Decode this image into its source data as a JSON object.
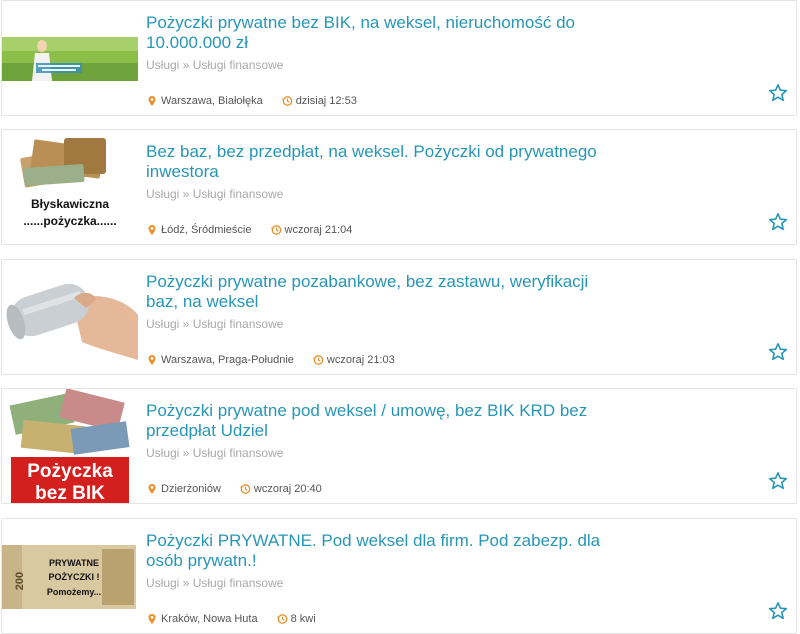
{
  "colors": {
    "title": "#2796b5",
    "category": "#a9a9a9",
    "meta_icon": "#e8912d",
    "star": "#2796b5"
  },
  "listings": [
    {
      "title": "Pożyczki prywatne bez BIK, na weksel, nieruchomość do 10.000.000 zł",
      "category": "Usługi » Usługi finansowe",
      "location": "Warszawa, Białołęka",
      "time": "dzisiaj 12:53",
      "thumb_icon": "woman-in-field-photo"
    },
    {
      "title": "Bez baz, bez przedpłat, na weksel. Pożyczki od prywatnego inwestora",
      "category": "Usługi » Usługi finansowe",
      "location": "Łódź, Śródmieście",
      "time": "wczoraj 21:04",
      "thumb_icon": "banknotes-photo",
      "thumb_text": [
        "Błyskawiczna",
        "......pożyczka......"
      ]
    },
    {
      "title": "Pożyczki prywatne pozabankowe, bez zastawu, weryfikacji baz, na weksel",
      "category": "Usługi » Usługi finansowe",
      "location": "Warszawa, Praga-Południe",
      "time": "wczoraj 21:03",
      "thumb_icon": "hand-with-money-roll-photo"
    },
    {
      "title": "Pożyczki prywatne pod weksel / umowę, bez BIK KRD bez przedpłat Udziel",
      "category": "Usługi » Usługi finansowe",
      "location": "Dzierżoniów",
      "time": "wczoraj 20:40",
      "thumb_icon": "banknotes-stack-photo",
      "thumb_text": [
        "Pożyczka",
        "bez BIK"
      ]
    },
    {
      "title": "Pożyczki PRYWATNE. Pod weksel dla firm. Pod zabezp. dla osób prywatn.!",
      "category": "Usługi » Usługi finansowe",
      "location": "Kraków, Nowa Huta",
      "time": "8 kwi",
      "thumb_icon": "banknote-200-photo",
      "thumb_text": [
        "PRYWATNE",
        "POŻYCZKI !",
        "Pomożemy..."
      ]
    }
  ]
}
